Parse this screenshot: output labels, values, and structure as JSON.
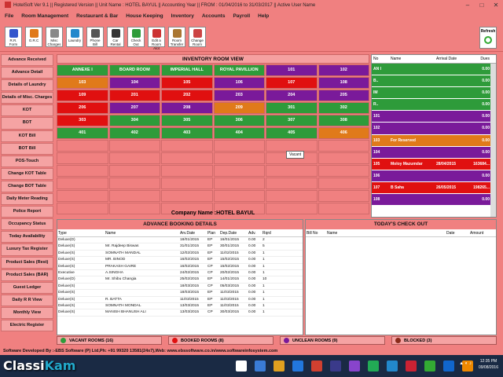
{
  "titlebar": {
    "text": "HotelSoft Ver 9.1  || Registered Version ||  Unit Name : HOTEL BAYUL   || Accounting Year || FROM : 01/04/2016 to 31/03/2017    || Active User Name"
  },
  "menu": [
    "File",
    "Room Management",
    "Restaurant & Bar",
    "House Keeping",
    "Inventory",
    "Accounts",
    "Payroll",
    "Help"
  ],
  "toolbar": [
    {
      "label": "R.R. Form",
      "color": "#3355cc"
    },
    {
      "label": "G.R.C",
      "color": "#e07a1a"
    },
    {
      "label": "Misc Charges",
      "color": "#888888"
    },
    {
      "label": "Laundry",
      "color": "#2288cc"
    },
    {
      "label": "Phone Bill",
      "color": "#555555"
    },
    {
      "label": "Car Rental",
      "color": "#333333"
    },
    {
      "label": "Check Out",
      "color": "#2e9b3a"
    },
    {
      "label": "Edit a Room Alot",
      "color": "#cc3333"
    },
    {
      "label": "Room Transfer",
      "color": "#aa7733"
    },
    {
      "label": "Change Room",
      "color": "#cc4444"
    }
  ],
  "refresh_label": "Refresh",
  "nav": [
    "Advance Received",
    "Advance Detail",
    "Details of Laundry",
    "Details of Misc. Charges",
    "KOT",
    "BOT",
    "KOT Bill",
    "BOT Bill",
    "POS-Touch",
    "Change KOT Table",
    "Change BOT Table",
    "Daily Meter Reading",
    "Police Report",
    "Occupancy Status",
    "Today Availability",
    "Luxury Tax Register",
    "Product Sales (Rest)",
    "Product Sales (BAR)",
    "Guest Ledger",
    "Daily R R View",
    "Monthly View",
    "Electric Register"
  ],
  "inventory": {
    "title": "INVENTORY ROOM VIEW",
    "headers": [
      "ANNEXE I",
      "BOARD ROOM",
      "IMPERIAL HALL",
      "ROYAL PAVILLION",
      "101",
      "102"
    ],
    "header_colors": [
      "green",
      "green",
      "green",
      "green",
      "purple",
      "purple"
    ],
    "rows": [
      [
        {
          "n": "103",
          "c": "orange"
        },
        {
          "n": "104",
          "c": "purple"
        },
        {
          "n": "105",
          "c": "red"
        },
        {
          "n": "106",
          "c": "purple"
        },
        {
          "n": "107",
          "c": "red"
        },
        {
          "n": "108",
          "c": "purple"
        }
      ],
      [
        {
          "n": "109",
          "c": "red"
        },
        {
          "n": "201",
          "c": "red"
        },
        {
          "n": "202",
          "c": "red"
        },
        {
          "n": "203",
          "c": "purple"
        },
        {
          "n": "204",
          "c": "purple"
        },
        {
          "n": "205",
          "c": "purple"
        }
      ],
      [
        {
          "n": "206",
          "c": "red"
        },
        {
          "n": "207",
          "c": "purple"
        },
        {
          "n": "208",
          "c": "purple"
        },
        {
          "n": "209",
          "c": "orange"
        },
        {
          "n": "301",
          "c": "green"
        },
        {
          "n": "302",
          "c": "green"
        }
      ],
      [
        {
          "n": "303",
          "c": "red"
        },
        {
          "n": "304",
          "c": "green"
        },
        {
          "n": "305",
          "c": "green"
        },
        {
          "n": "306",
          "c": "green"
        },
        {
          "n": "307",
          "c": "green"
        },
        {
          "n": "308",
          "c": "green"
        }
      ],
      [
        {
          "n": "401",
          "c": "green"
        },
        {
          "n": "402",
          "c": "green"
        },
        {
          "n": "403",
          "c": "green"
        },
        {
          "n": "404",
          "c": "green"
        },
        {
          "n": "405",
          "c": "green"
        },
        {
          "n": "406",
          "c": "orange"
        }
      ]
    ],
    "empty_rows": 6,
    "tooltip": "Vacant"
  },
  "company": "Company Name :HOTEL BAYUL",
  "right_list": {
    "headers": {
      "no": "No",
      "name": "Name",
      "arrival": "Arrival Date",
      "dues": "Dues"
    },
    "rows": [
      {
        "no": "AN I",
        "name": "",
        "date": "",
        "due": "0.00",
        "c": "green"
      },
      {
        "no": "B..",
        "name": "",
        "date": "",
        "due": "0.00",
        "c": "green"
      },
      {
        "no": "IM",
        "name": "",
        "date": "",
        "due": "0.00",
        "c": "green"
      },
      {
        "no": "R..",
        "name": "",
        "date": "",
        "due": "0.00",
        "c": "green"
      },
      {
        "no": "101",
        "name": "",
        "date": "",
        "due": "0.00",
        "c": "purple"
      },
      {
        "no": "102",
        "name": "",
        "date": "",
        "due": "0.00",
        "c": "purple"
      },
      {
        "no": "103",
        "name": "For Reserved",
        "date": "",
        "due": "0.00",
        "c": "orange"
      },
      {
        "no": "104",
        "name": "",
        "date": "",
        "due": "0.00",
        "c": "purple"
      },
      {
        "no": "105",
        "name": "Moloy Mazumdar",
        "date": "28/04/2015",
        "due": "163684...",
        "c": "red"
      },
      {
        "no": "106",
        "name": "",
        "date": "",
        "due": "0.00",
        "c": "purple"
      },
      {
        "no": "107",
        "name": "B Saha",
        "date": "26/05/2015",
        "due": "198265...",
        "c": "red"
      },
      {
        "no": "108",
        "name": "",
        "date": "",
        "due": "0.00",
        "c": "purple"
      }
    ]
  },
  "advance_booking": {
    "title": "ADVANCE BOOKING DETAILS",
    "headers": {
      "type": "Type",
      "name": "Name",
      "arv": "Arv.Date",
      "plan": "Plan",
      "dep": "Dep.Date",
      "adv": "Adv.",
      "rq": "Rqrd"
    },
    "rows": [
      [
        "Deluxe(D)",
        "",
        "18/01/2015",
        "EP",
        "16/01/2015",
        "0.00",
        "2"
      ],
      [
        "Deluxe(S)",
        "Mr. Rajdeep Biswas",
        "31/01/2015",
        "EP",
        "30/01/2015",
        "0.00",
        "5"
      ],
      [
        "Deluxe(S)",
        "SOMNATH MANDAL",
        "12/02/2015",
        "EP",
        "11/02/2015",
        "0.00",
        "1"
      ],
      [
        "Deluxe(S)",
        "MR. BINOD",
        "16/02/2015",
        "EP",
        "15/02/2015",
        "0.00",
        "1"
      ],
      [
        "Deluxe(S)",
        "PRAKASH GAIRE",
        "16/02/2015",
        "CP",
        "15/02/2015",
        "0.00",
        "1"
      ],
      [
        "Executive",
        "A.SINGHA",
        "24/02/2015",
        "CP",
        "20/02/2015",
        "0.00",
        "1"
      ],
      [
        "Deluxe(D)",
        "Mr. Shibu Changia",
        "25/02/2015",
        "EP",
        "14/01/2015",
        "0.00",
        "10"
      ],
      [
        "Deluxe(S)",
        "",
        "18/03/2015",
        "CP",
        "05/03/2015",
        "0.00",
        "1"
      ],
      [
        "Deluxe(S)",
        "",
        "18/03/2015",
        "EP",
        "11/03/2015",
        "0.00",
        "1"
      ],
      [
        "Deluxe(S)",
        "R. BATTA",
        "11/03/2015",
        "EP",
        "11/03/2015",
        "0.00",
        "1"
      ],
      [
        "Deluxe(S)",
        "SOMNATH MONDAL",
        "13/03/2015",
        "EP",
        "11/03/2015",
        "0.00",
        "1"
      ],
      [
        "Deluxe(S)",
        "MANISH BHANUSH ALI",
        "13/03/2015",
        "CP",
        "30/03/2015",
        "0.00",
        "1"
      ]
    ]
  },
  "checkout": {
    "title": "TODAY'S CHECK OUT",
    "headers": {
      "no": "Bill No",
      "name": "Name",
      "date": "Date",
      "amt": "Amount"
    }
  },
  "legend": [
    {
      "label": "VACANT ROOMS (16)",
      "color": "#2e9b3a"
    },
    {
      "label": "BOOKED ROOMS (8)",
      "color": "#e01010"
    },
    {
      "label": "UNCLEAN ROOMS (9)",
      "color": "#7a1a9a"
    },
    {
      "label": "BLOCKED (3)",
      "color": "#8a2a1a"
    }
  ],
  "footer": "Software Developed By :-EBS Software (P) Ltd,Ph: +91 99320 13581(24x7),Web: www.ebssoftware.co.in/www.softwareinfosystem.com",
  "watermark": {
    "a": "Classi",
    "b": "Kam",
    ".com": ".com"
  },
  "clock": {
    "time": "12:35 PM",
    "date": "09/08/2016"
  },
  "taskbar_icons": [
    "#3a7bd5",
    "#e0a020",
    "#2277dd",
    "#d04030",
    "#3a3a8a",
    "#8844cc",
    "#22aa55",
    "#2288cc",
    "#cc2233",
    "#33aa33",
    "#1166cc",
    "#ee8800"
  ]
}
